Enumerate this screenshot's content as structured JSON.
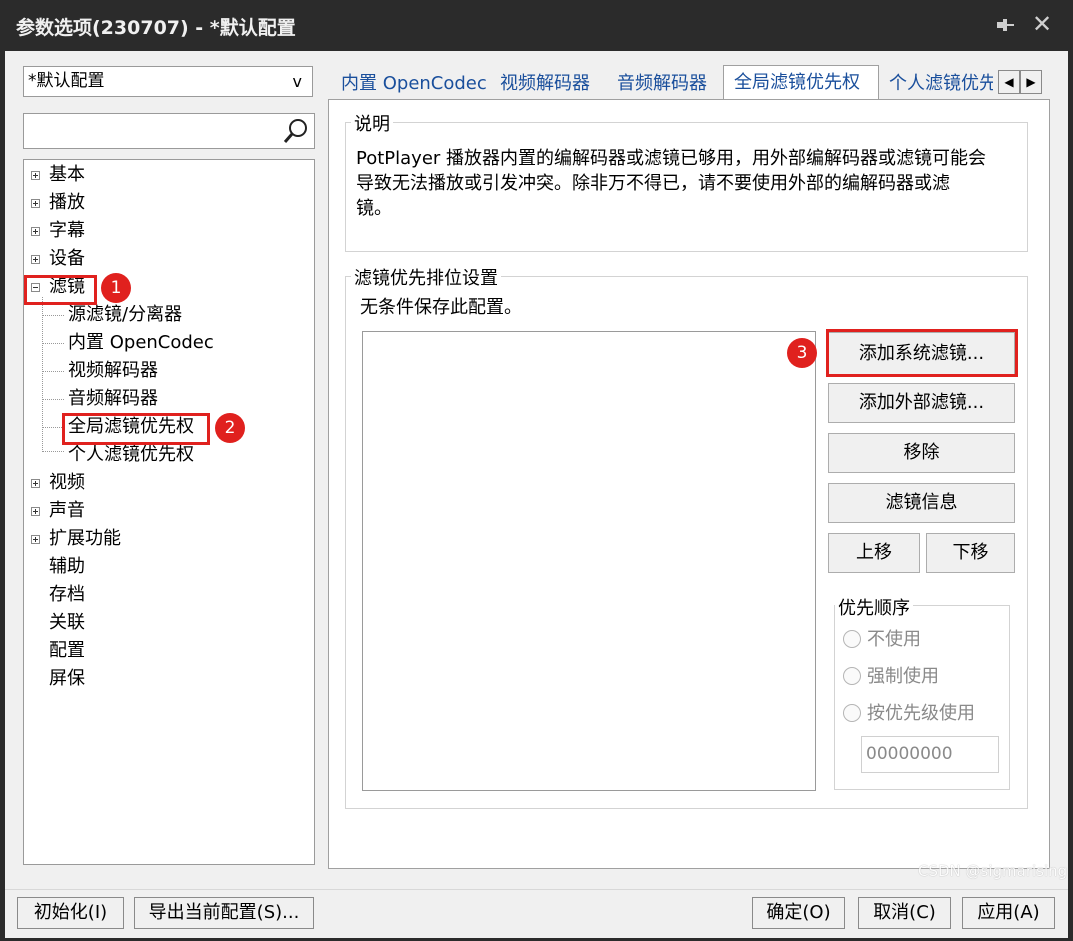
{
  "window": {
    "title": "参数选项(230707) - *默认配置"
  },
  "profile": {
    "selected": "*默认配置",
    "arrow": "v"
  },
  "search": {
    "value": ""
  },
  "tree": {
    "items": [
      {
        "label": "基本",
        "expander": "plus"
      },
      {
        "label": "播放",
        "expander": "plus"
      },
      {
        "label": "字幕",
        "expander": "plus"
      },
      {
        "label": "设备",
        "expander": "plus"
      },
      {
        "label": "滤镜",
        "expander": "minus"
      },
      {
        "label": "源滤镜/分离器"
      },
      {
        "label": "内置 OpenCodec"
      },
      {
        "label": "视频解码器"
      },
      {
        "label": "音频解码器"
      },
      {
        "label": "全局滤镜优先权"
      },
      {
        "label": "个人滤镜优先权"
      },
      {
        "label": "视频",
        "expander": "plus"
      },
      {
        "label": "声音",
        "expander": "plus"
      },
      {
        "label": "扩展功能",
        "expander": "plus"
      },
      {
        "label": "辅助"
      },
      {
        "label": "存档"
      },
      {
        "label": "关联"
      },
      {
        "label": "配置"
      },
      {
        "label": "屏保"
      }
    ]
  },
  "annotations": {
    "badge1": "1",
    "badge2": "2",
    "badge3": "3",
    "highlight_color": "#e0211e"
  },
  "tabs": {
    "items": [
      "内置 OpenCodec",
      "视频解码器",
      "音频解码器",
      "全局滤镜优先权",
      "个人滤镜优先"
    ],
    "active": "全局滤镜优先权",
    "scroll_left": "◀",
    "scroll_right": "▶"
  },
  "description": {
    "group_label": "说明",
    "line1": "PotPlayer 播放器内置的编解码器或滤镜已够用，用外部编解码器或滤镜可能会",
    "line2": "导致无法播放或引发冲突。除非万不得已，请不要使用外部的编解码器或滤",
    "line3": "镜。"
  },
  "priority": {
    "group_label": "滤镜优先排位设置",
    "note": "无条件保存此配置。",
    "buttons": {
      "add_system": "添加系统滤镜...",
      "add_external": "添加外部滤镜...",
      "remove": "移除",
      "info": "滤镜信息",
      "move_up": "上移",
      "move_down": "下移"
    },
    "order": {
      "label": "优先顺序",
      "options": [
        "不使用",
        "强制使用",
        "按优先级使用"
      ],
      "value": "00000000"
    }
  },
  "footer": {
    "init": "初始化(I)",
    "export": "导出当前配置(S)...",
    "ok": "确定(O)",
    "cancel": "取消(C)",
    "apply": "应用(A)"
  },
  "watermark": "CSDN @sigmarising"
}
